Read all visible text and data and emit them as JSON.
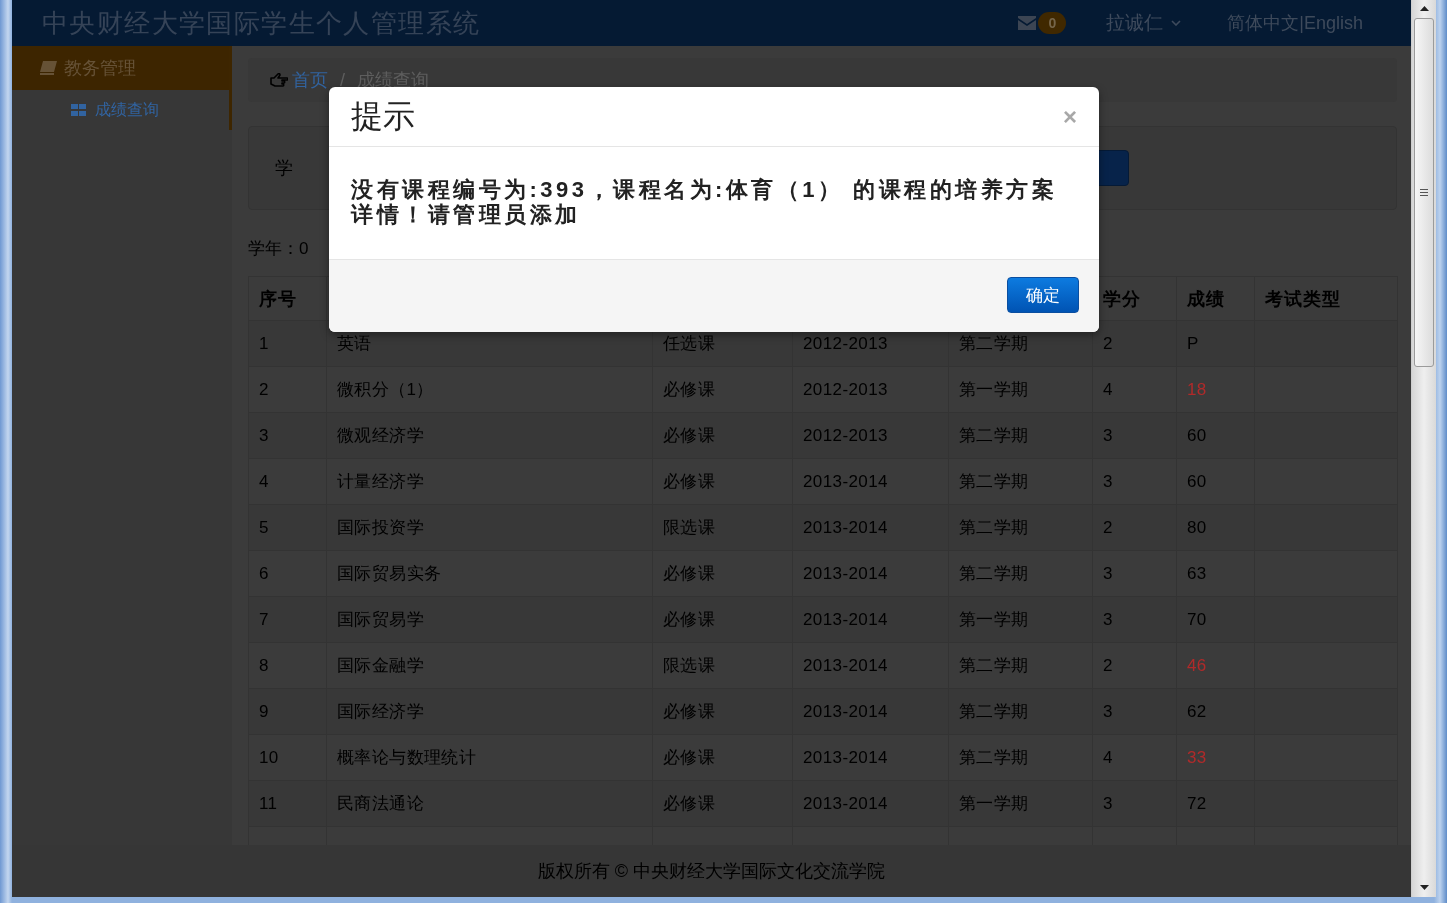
{
  "header": {
    "title": "中央财经大学国际学生个人管理系统",
    "message_count": "0",
    "user": "拉诚仁",
    "languages": [
      "简体中文",
      "English"
    ],
    "language_separator": "|"
  },
  "sidebar": {
    "sections": [
      {
        "label": "教务管理",
        "children": [
          {
            "label": "成绩查询",
            "selected": true
          }
        ]
      }
    ]
  },
  "breadcrumb": {
    "items": [
      {
        "label": "首页",
        "current": false
      },
      {
        "label": "成绩查询",
        "current": true
      }
    ],
    "separator": "/"
  },
  "search_panel": {
    "label": "学"
  },
  "summary": "学年：0",
  "table": {
    "columns": [
      "序号",
      null,
      null,
      null,
      null,
      "学分",
      "成绩",
      "考试类型"
    ],
    "rows": [
      {
        "cells": [
          "1",
          "英语",
          "任选课",
          "2012-2013",
          "第二学期",
          "2"
        ],
        "score": "P",
        "failing": false
      },
      {
        "cells": [
          "2",
          "微积分（1）",
          "必修课",
          "2012-2013",
          "第一学期",
          "4"
        ],
        "score": "18",
        "failing": true
      },
      {
        "cells": [
          "3",
          "微观经济学",
          "必修课",
          "2012-2013",
          "第二学期",
          "3"
        ],
        "score": "60",
        "failing": false
      },
      {
        "cells": [
          "4",
          "计量经济学",
          "必修课",
          "2013-2014",
          "第二学期",
          "3"
        ],
        "score": "60",
        "failing": false
      },
      {
        "cells": [
          "5",
          "国际投资学",
          "限选课",
          "2013-2014",
          "第二学期",
          "2"
        ],
        "score": "80",
        "failing": false
      },
      {
        "cells": [
          "6",
          "国际贸易实务",
          "必修课",
          "2013-2014",
          "第二学期",
          "3"
        ],
        "score": "63",
        "failing": false
      },
      {
        "cells": [
          "7",
          "国际贸易学",
          "必修课",
          "2013-2014",
          "第一学期",
          "3"
        ],
        "score": "70",
        "failing": false
      },
      {
        "cells": [
          "8",
          "国际金融学",
          "限选课",
          "2013-2014",
          "第二学期",
          "2"
        ],
        "score": "46",
        "failing": true
      },
      {
        "cells": [
          "9",
          "国际经济学",
          "必修课",
          "2013-2014",
          "第二学期",
          "3"
        ],
        "score": "62",
        "failing": false
      },
      {
        "cells": [
          "10",
          "概率论与数理统计",
          "必修课",
          "2013-2014",
          "第二学期",
          "4"
        ],
        "score": "33",
        "failing": true
      },
      {
        "cells": [
          "11",
          "民商法通论",
          "必修课",
          "2013-2014",
          "第一学期",
          "3"
        ],
        "score": "72",
        "failing": false
      }
    ]
  },
  "dialog": {
    "title": "提示",
    "close": "×",
    "message": "没有课程编号为:393，课程名为:体育（1） 的课程的培养方案详情！请管理员添加",
    "buttons": [
      "确定"
    ]
  },
  "footer": {
    "text": "版权所有 © 中央财经大学国际文化交流学院"
  }
}
